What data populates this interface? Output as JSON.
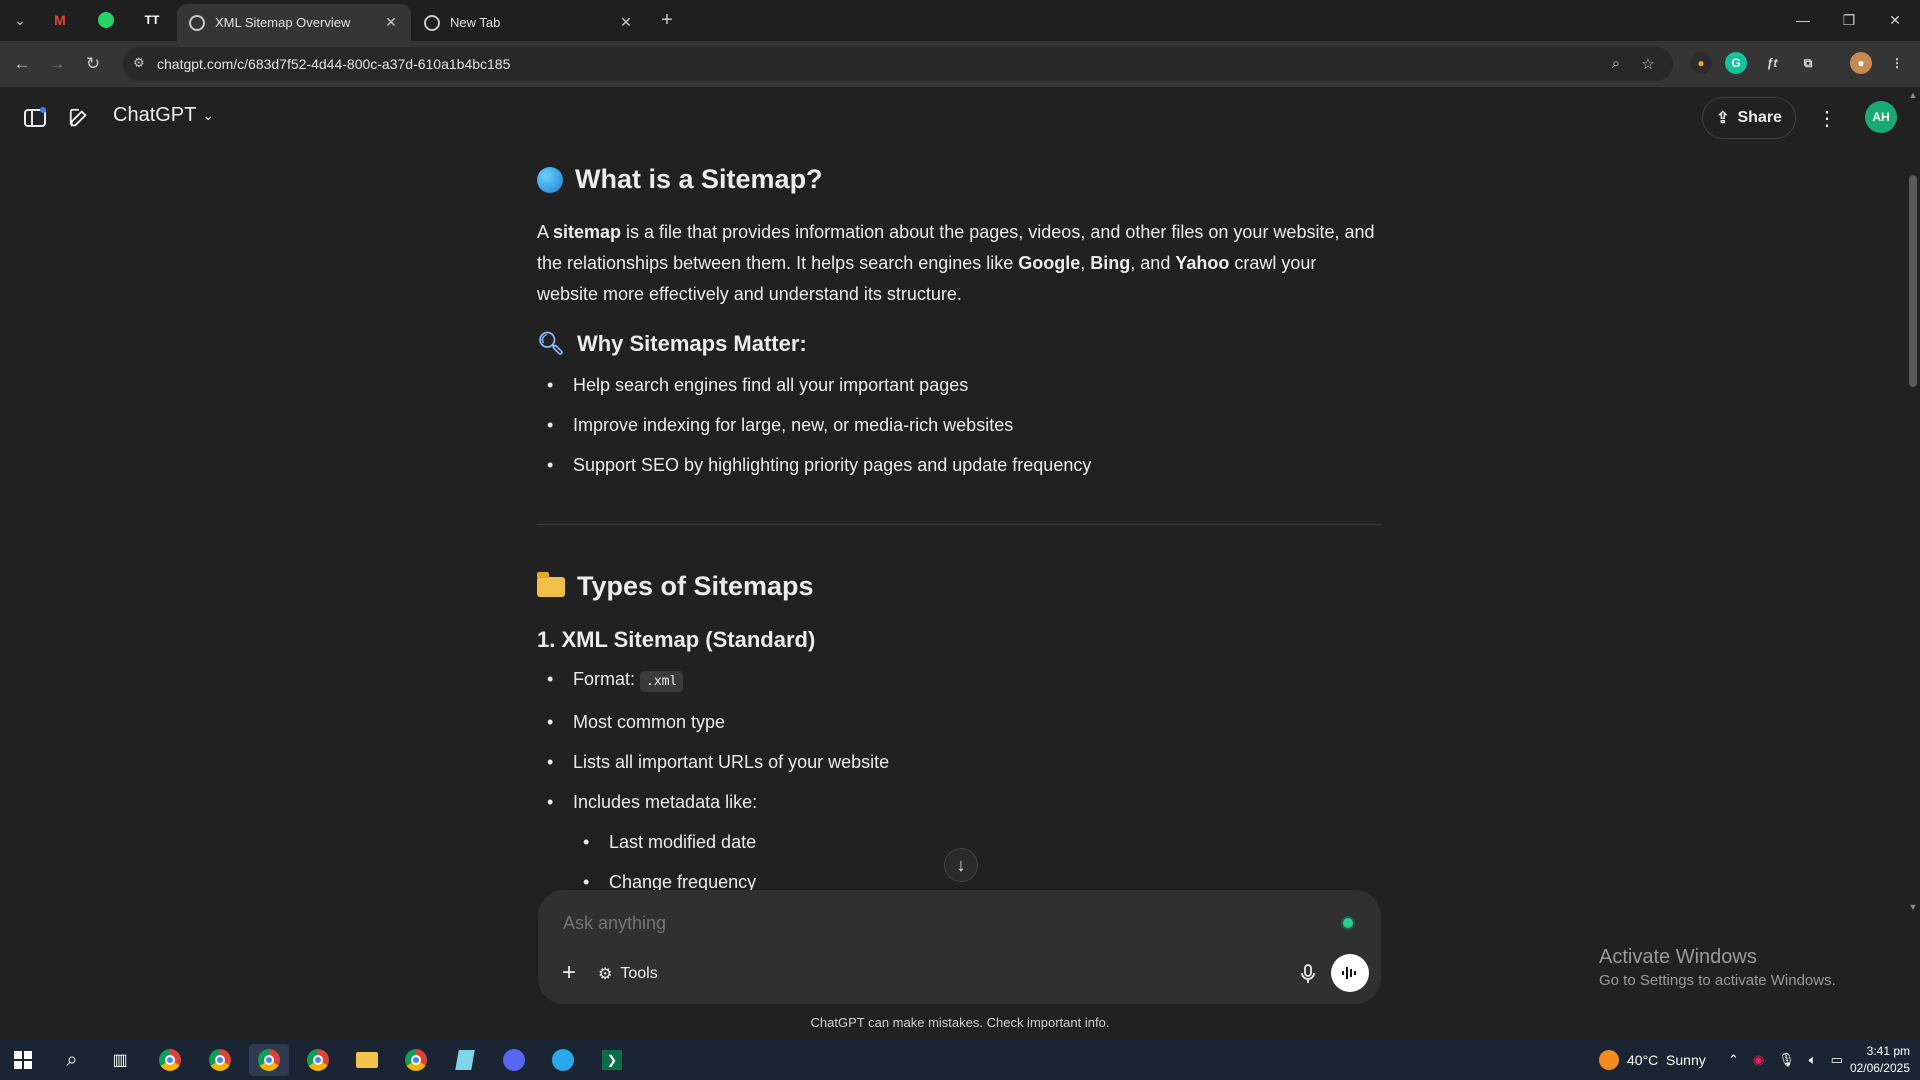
{
  "browser": {
    "tabs": [
      {
        "title": "XML Sitemap Overview",
        "active": true
      },
      {
        "title": "New Tab",
        "active": false
      }
    ],
    "url": "chatgpt.com/c/683d7f52-4d44-800c-a37d-610a1b4bc185",
    "pinned_icons": [
      "gmail-icon",
      "whatsapp-icon",
      "tt-icon"
    ]
  },
  "header": {
    "model_label": "ChatGPT",
    "share_label": "Share",
    "avatar_initials": "AH"
  },
  "content": {
    "section1": {
      "heading": "What is a Sitemap?",
      "p_a": "A ",
      "p_b": "sitemap",
      "p_c": " is a file that provides information about the pages, videos, and other files on your website, and the relationships between them. It helps search engines like ",
      "google": "Google",
      "comma": ", ",
      "bing": "Bing",
      "and": ", and ",
      "yahoo": "Yahoo",
      "p_end": " crawl your website more effectively and understand its structure."
    },
    "section2": {
      "heading": "Why Sitemaps Matter:",
      "items": [
        "Help search engines find all your important pages",
        "Improve indexing for large, new, or media-rich websites",
        "Support SEO by highlighting priority pages and update frequency"
      ]
    },
    "section3": {
      "heading": "Types of Sitemaps",
      "subheading": "1. XML Sitemap (Standard)",
      "format_label": "Format: ",
      "format_code": ".xml",
      "items": [
        "Most common type",
        "Lists all important URLs of your website",
        "Includes metadata like:"
      ],
      "sub_items": [
        "Last modified date",
        "Change frequency"
      ]
    }
  },
  "composer": {
    "placeholder": "Ask anything",
    "tools_label": "Tools",
    "disclaimer": "ChatGPT can make mistakes. Check important info."
  },
  "watermark": {
    "title": "Activate Windows",
    "subtitle": "Go to Settings to activate Windows."
  },
  "taskbar": {
    "weather": "40°C  Sunny",
    "time": "3:41 pm",
    "date": "02/06/2025"
  }
}
